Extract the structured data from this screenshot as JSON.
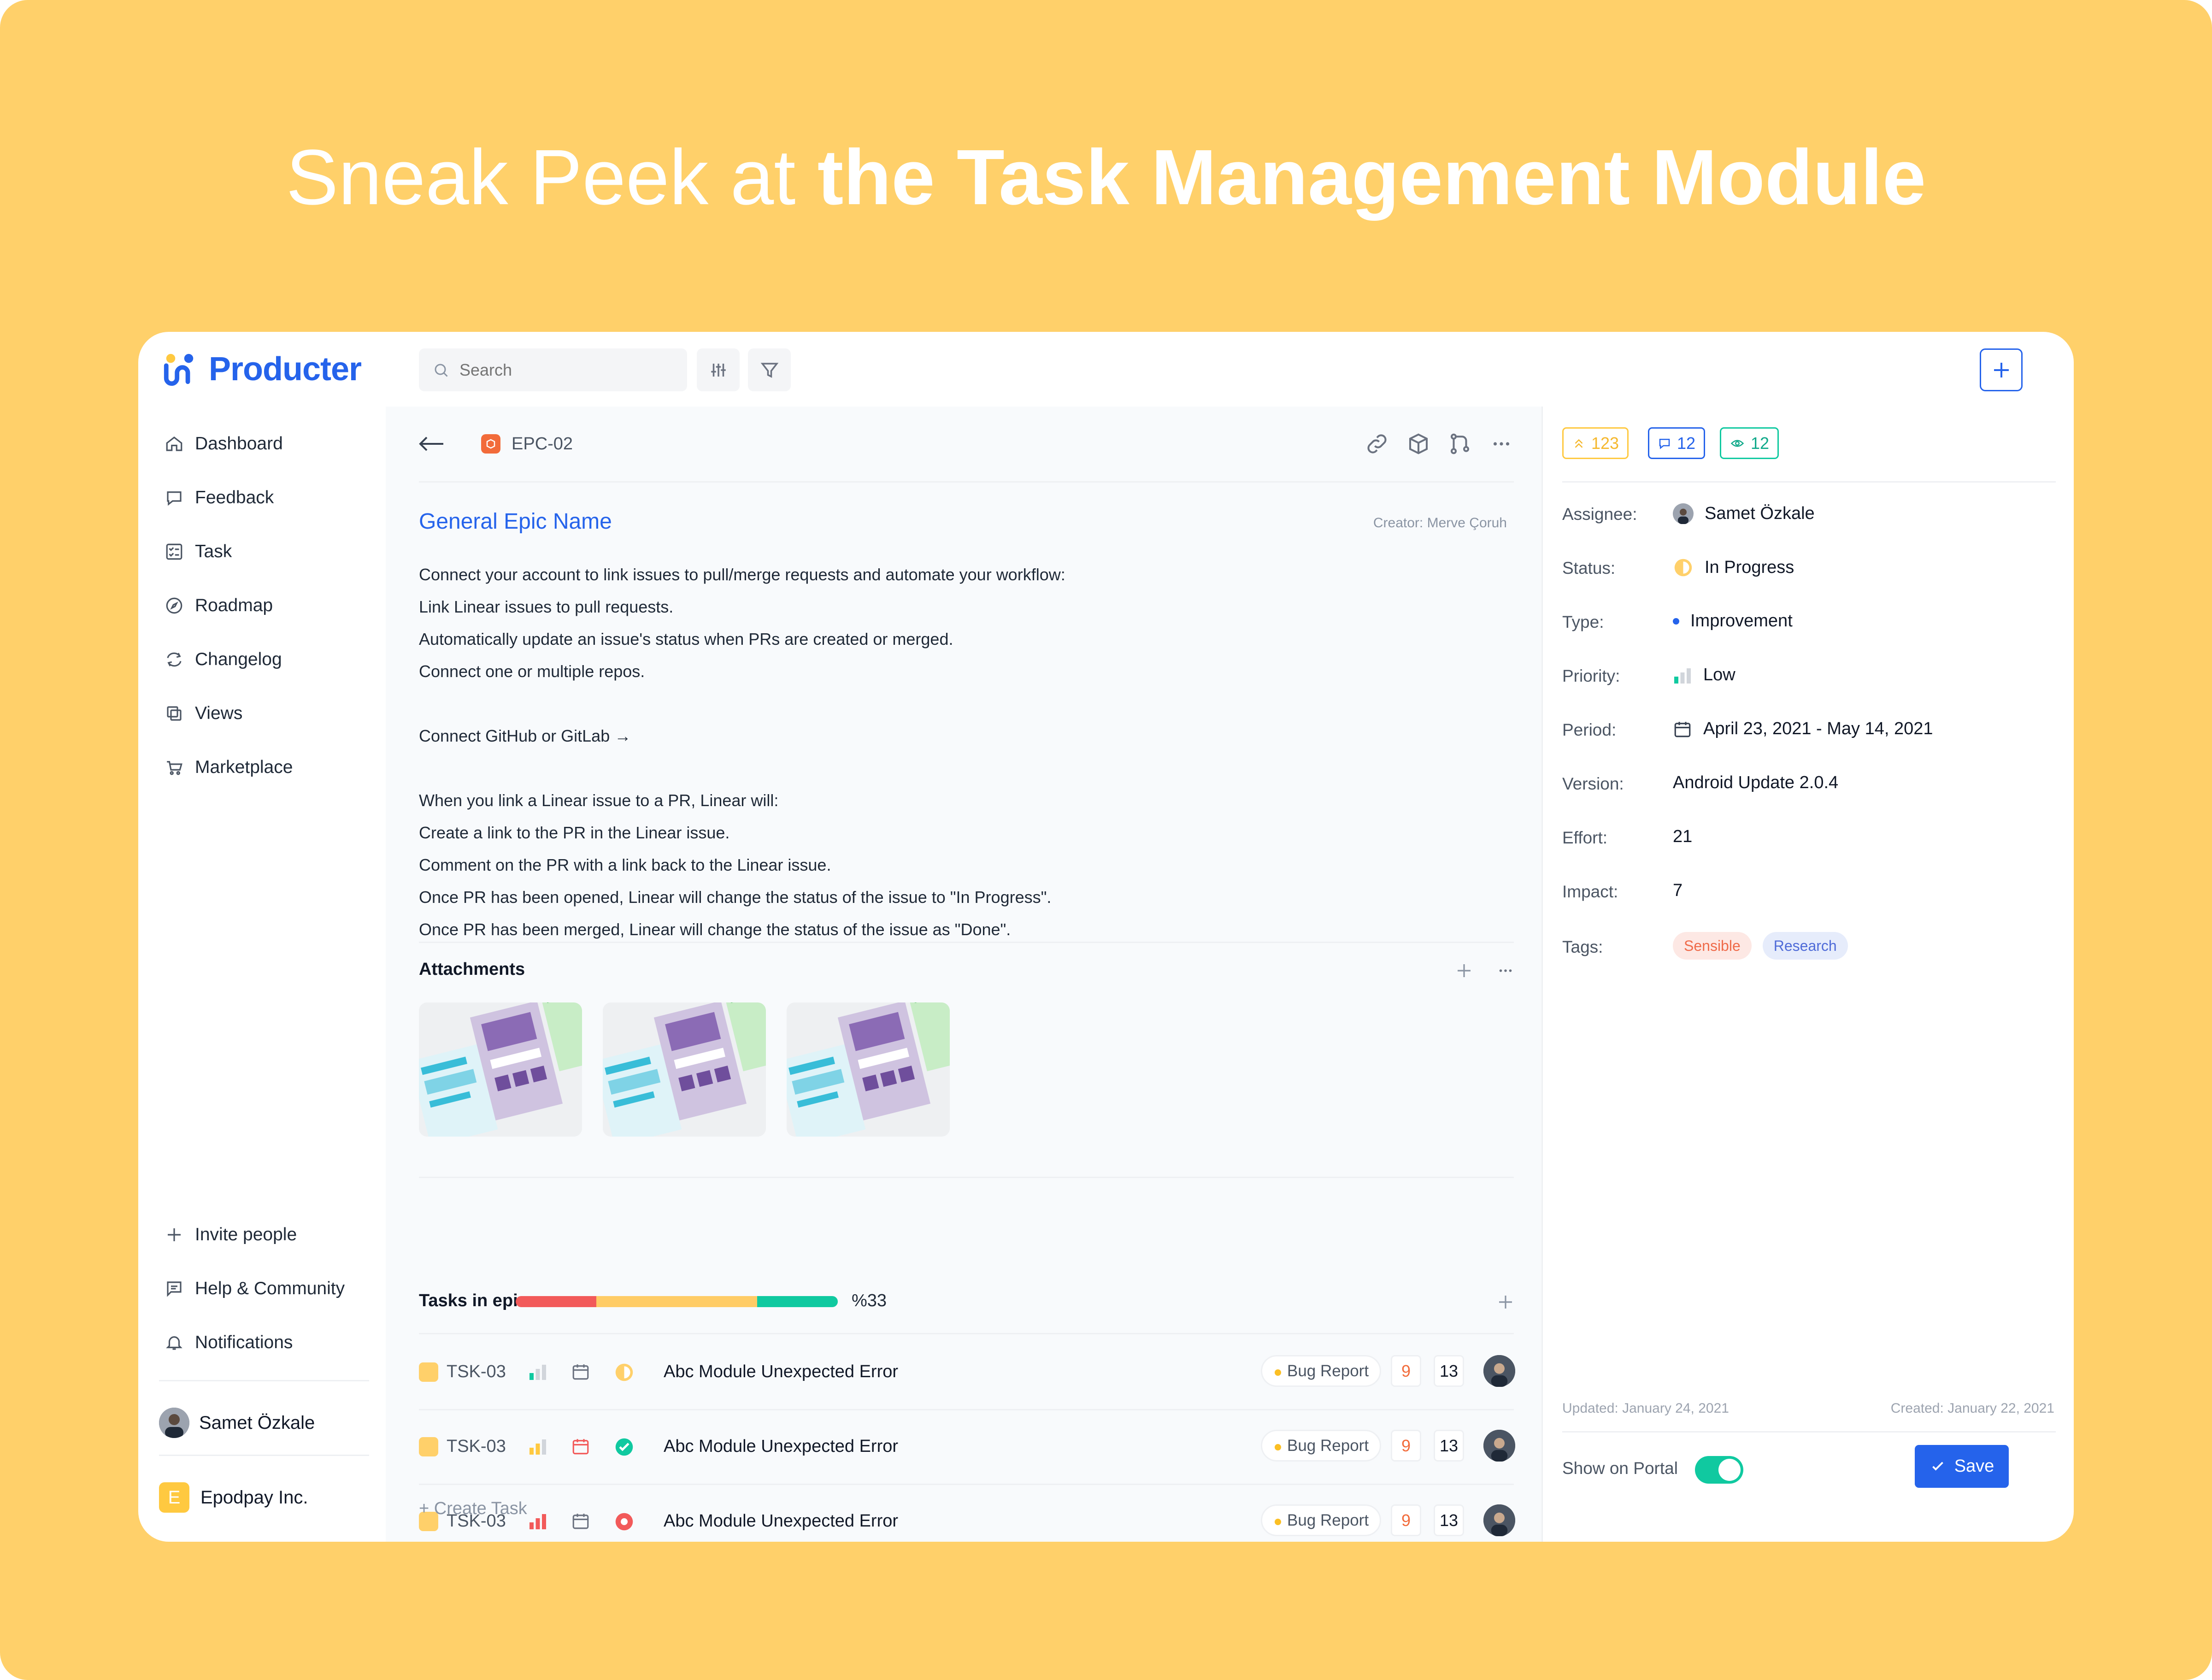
{
  "headline": {
    "light": "Sneak Peek at ",
    "bold": "the Task Management Module"
  },
  "app": {
    "name": "Producter"
  },
  "search": {
    "placeholder": "Search"
  },
  "sidebar": {
    "items": [
      {
        "label": "Dashboard",
        "icon": "home-icon"
      },
      {
        "label": "Feedback",
        "icon": "chat-icon"
      },
      {
        "label": "Task",
        "icon": "checklist-icon"
      },
      {
        "label": "Roadmap",
        "icon": "compass-icon"
      },
      {
        "label": "Changelog",
        "icon": "refresh-icon"
      },
      {
        "label": "Views",
        "icon": "copy-icon"
      },
      {
        "label": "Marketplace",
        "icon": "cart-icon"
      }
    ],
    "bottom": [
      {
        "label": "Invite people",
        "icon": "plus-icon"
      },
      {
        "label": "Help & Community",
        "icon": "message-icon"
      },
      {
        "label": "Notifications",
        "icon": "bell-icon"
      }
    ],
    "user": "Samet Özkale",
    "company": {
      "initial": "E",
      "name": "Epodpay Inc."
    }
  },
  "epic": {
    "id": "EPC-02",
    "title": "General Epic Name",
    "creator": "Creator: Merve Çoruh",
    "description": [
      "Connect your account to link issues to pull/merge requests and automate your workflow:",
      "Link Linear issues to pull requests.",
      "Automatically update an issue's status when PRs are created or merged.",
      "Connect one or multiple repos.",
      "",
      "Connect GitHub or GitLab →",
      "",
      "When you link a Linear issue to a PR, Linear will:",
      "Create a link to the PR in the Linear issue.",
      "Comment on the PR with a link back to the Linear issue.",
      "Once PR has been opened, Linear will change the status of the issue to \"In Progress\".",
      "Once PR has been merged, Linear will change the status of the issue as \"Done\"."
    ]
  },
  "attachments": {
    "title": "Attachments",
    "count": 3
  },
  "tasks": {
    "title": "Tasks in epic",
    "percent_label": "%33",
    "progress": [
      {
        "fraction": 0.25,
        "color": "#f25a5a"
      },
      {
        "fraction": 0.5,
        "color": "#ffcc66"
      },
      {
        "fraction": 0.25,
        "color": "#10c9a0"
      }
    ],
    "rows": [
      {
        "id": "TSK-03",
        "name": "Abc Module Unexpected Error",
        "tag": "Bug Report",
        "a": "9",
        "b": "13",
        "status": "in-progress",
        "priority": "low"
      },
      {
        "id": "TSK-03",
        "name": "Abc Module Unexpected Error",
        "tag": "Bug Report",
        "a": "9",
        "b": "13",
        "status": "done",
        "priority": "medium"
      },
      {
        "id": "TSK-03",
        "name": "Abc Module Unexpected Error",
        "tag": "Bug Report",
        "a": "9",
        "b": "13",
        "status": "blocked",
        "priority": "high"
      }
    ],
    "create_label": "+ Create Task"
  },
  "stats": {
    "upvotes": "123",
    "comments": "12",
    "views": "12"
  },
  "props": {
    "assignee_label": "Assignee:",
    "assignee": "Samet Özkale",
    "status_label": "Status:",
    "status": "In Progress",
    "type_label": "Type:",
    "type": "Improvement",
    "priority_label": "Priority:",
    "priority": "Low",
    "period_label": "Period:",
    "period": "April 23, 2021 - May 14, 2021",
    "version_label": "Version:",
    "version": "Android Update 2.0.4",
    "effort_label": "Effort:",
    "effort": "21",
    "impact_label": "Impact:",
    "impact": "7",
    "tags_label": "Tags:",
    "tags": [
      "Sensible",
      "Research"
    ]
  },
  "meta": {
    "updated": "Updated: January 24, 2021",
    "created": "Created: January 22, 2021"
  },
  "footer": {
    "portal_label": "Show on Portal",
    "portal_on": true,
    "save_label": "Save"
  },
  "colors": {
    "accent": "#2563eb",
    "background": "#ffd06a",
    "success": "#10c9a0",
    "danger": "#f25a5a",
    "warning": "#ffc940"
  }
}
